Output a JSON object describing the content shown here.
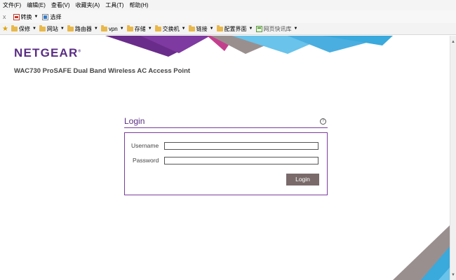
{
  "browser": {
    "menu": [
      "文件(F)",
      "编辑(E)",
      "查看(V)",
      "收藏夹(A)",
      "工具(T)",
      "帮助(H)"
    ],
    "commands": {
      "close": "x",
      "convert": "转换",
      "select": "选择"
    },
    "favorites": [
      "保修",
      "网站",
      "路由器",
      "vpn",
      "存储",
      "交换机",
      "链接",
      "配置界面",
      "网页快讯库"
    ]
  },
  "page": {
    "brand": "NETGEAR",
    "brand_mark": "®",
    "product": "WAC730 ProSAFE Dual Band Wireless AC Access Point",
    "login": {
      "title": "Login",
      "help": "?",
      "username_label": "Username",
      "password_label": "Password",
      "username_value": "",
      "password_value": "",
      "button": "Login"
    }
  },
  "colors": {
    "brand": "#5a2d83",
    "accent_blue": "#3aa9dc",
    "accent_gray": "#9a8f8f",
    "button": "#7a6a6a"
  }
}
